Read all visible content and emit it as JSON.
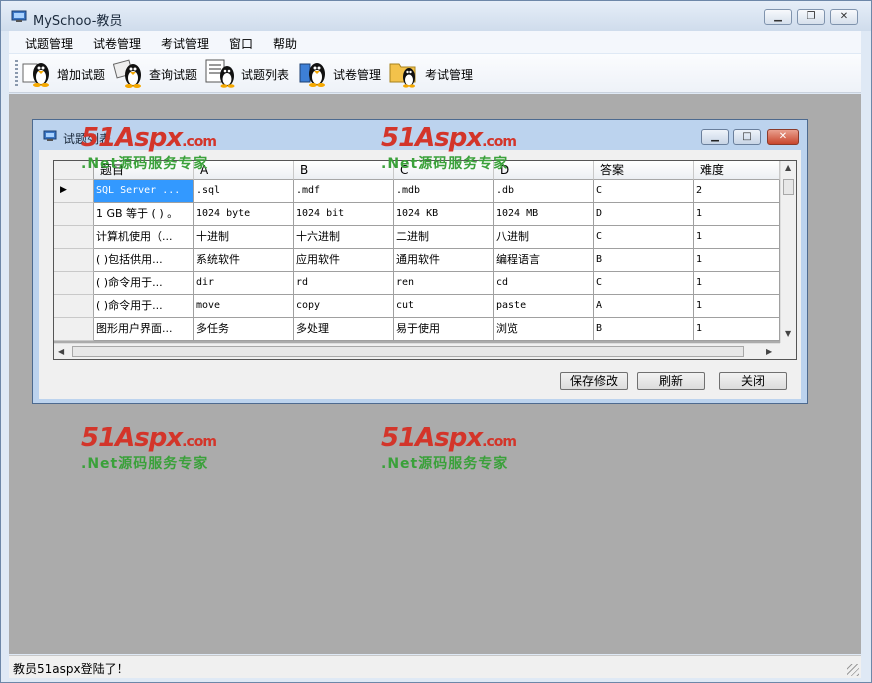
{
  "window": {
    "title": "MySchoo-教员"
  },
  "menu": [
    "试题管理",
    "试卷管理",
    "考试管理",
    "窗口",
    "帮助"
  ],
  "toolbar": [
    {
      "label": "增加试题",
      "icon": "penguin-add-icon"
    },
    {
      "label": "查询试题",
      "icon": "penguin-search-icon"
    },
    {
      "label": "试题列表",
      "icon": "penguin-list-icon"
    },
    {
      "label": "试卷管理",
      "icon": "penguin-paper-icon"
    },
    {
      "label": "考试管理",
      "icon": "penguin-folder-icon"
    }
  ],
  "child": {
    "title": "试题列表",
    "columns": [
      "题目",
      "A",
      "B",
      "C",
      "D",
      "答案",
      "难度"
    ],
    "rows": [
      [
        "SQL Server ...",
        ".sql",
        ".mdf",
        ".mdb",
        ".db",
        "C",
        "2"
      ],
      [
        "1 GB 等于 ( ) 。",
        "1024 byte",
        "1024 bit",
        "1024 KB",
        "1024 MB",
        "D",
        "1"
      ],
      [
        "计算机使用（...",
        "十进制",
        "十六进制",
        "二进制",
        "八进制",
        "C",
        "1"
      ],
      [
        "( )包括供用...",
        "系统软件",
        "应用软件",
        "通用软件",
        "编程语言",
        "B",
        "1"
      ],
      [
        "( )命令用于...",
        "dir",
        "rd",
        "ren",
        "cd",
        "C",
        "1"
      ],
      [
        "( )命令用于...",
        "move",
        "copy",
        "cut",
        "paste",
        "A",
        "1"
      ],
      [
        "图形用户界面...",
        "多任务",
        "多处理",
        "易于使用",
        "浏览",
        "B",
        "1"
      ]
    ],
    "buttons": {
      "save": "保存修改",
      "refresh": "刷新",
      "close": "关闭"
    }
  },
  "watermark": {
    "logo": "51Aspx",
    "suffix": ".com",
    "subtitle": ".Net源码服务专家"
  },
  "status": "教员51aspx登陆了！",
  "colors": {
    "selection": "#3399ff",
    "mdi_bg": "#ababab",
    "watermark_red": "#d3352a",
    "watermark_green": "#3aa13a"
  }
}
